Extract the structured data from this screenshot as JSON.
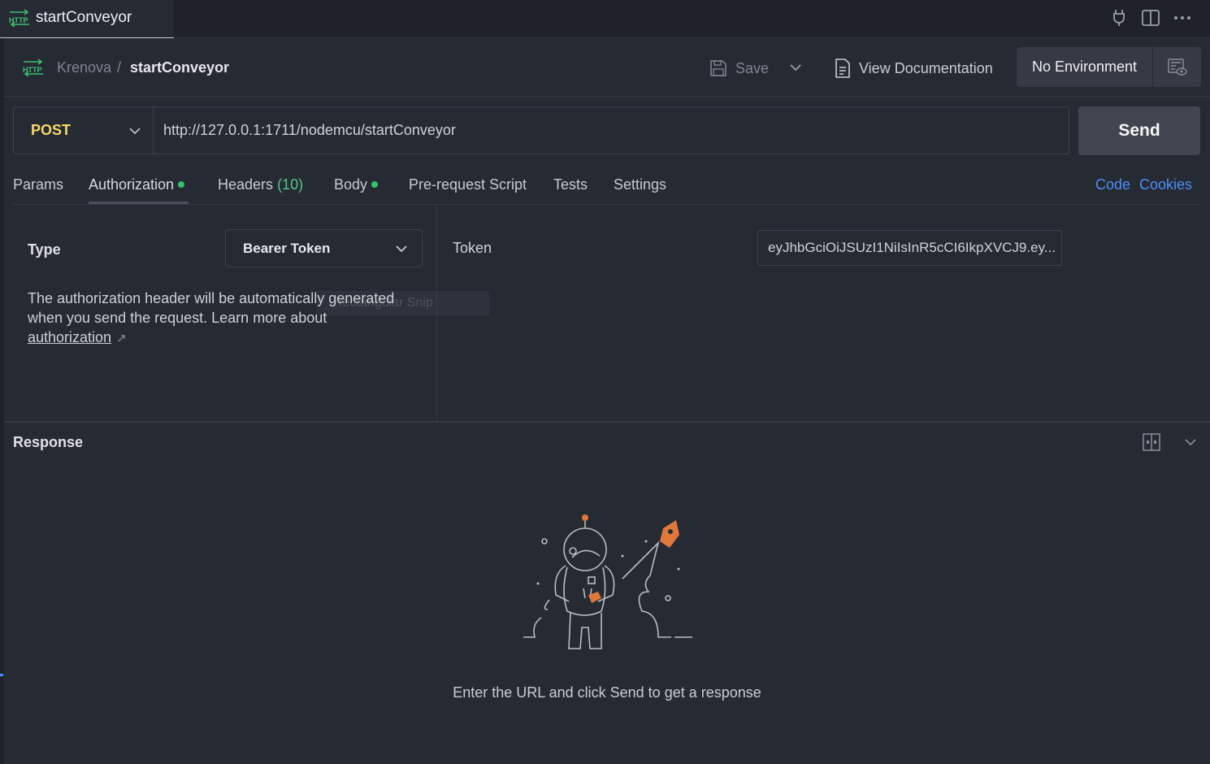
{
  "tab": {
    "title": "startConveyor",
    "icon": "http-icon"
  },
  "top_actions": [
    {
      "icon": "plug-icon"
    },
    {
      "icon": "split-pane-icon"
    },
    {
      "icon": "more-icon"
    }
  ],
  "header": {
    "breadcrumb_parent": "Krenova",
    "breadcrumb_sep": "/",
    "breadcrumb_current": "startConveyor",
    "save_label": "Save",
    "docs_label": "View Documentation",
    "environment": "No Environment"
  },
  "request": {
    "method": "POST",
    "url": "http://127.0.0.1:1711/nodemcu/startConveyor",
    "send_label": "Send"
  },
  "tabs": {
    "params": "Params",
    "authorization": "Authorization",
    "headers": "Headers",
    "headers_count": "(10)",
    "body": "Body",
    "prerequest": "Pre-request Script",
    "tests": "Tests",
    "settings": "Settings",
    "code": "Code",
    "cookies": "Cookies"
  },
  "auth": {
    "type_label": "Type",
    "type_value": "Bearer Token",
    "help_text": "The authorization header will be automatically generated when you send the request. Learn more about ",
    "help_link": "authorization",
    "ghost_text": "Rectangular Snip",
    "token_label": "Token",
    "token_value": "eyJhbGciOiJSUzI1NiIsInR5cCI6IkpXVCJ9.ey..."
  },
  "response": {
    "title": "Response",
    "empty_message": "Enter the URL and click Send to get a response"
  },
  "colors": {
    "background": "#262a33",
    "method_post": "#f6d768",
    "link": "#4d8ef5",
    "status_dot": "#2fc36a",
    "accent_orange": "#e0783a"
  }
}
